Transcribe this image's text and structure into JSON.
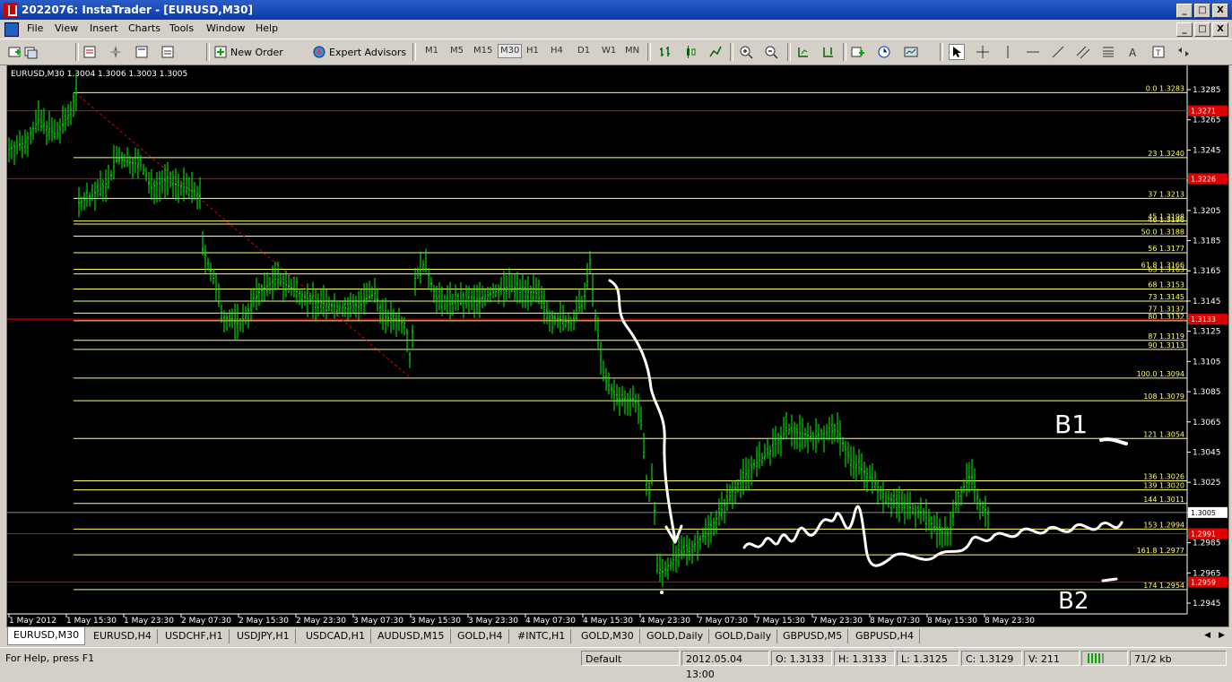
{
  "window": {
    "title": "2022076: InstaTrader - [EURUSD,M30]",
    "min": "_",
    "max": "□",
    "close": "X"
  },
  "menu": [
    "File",
    "View",
    "Insert",
    "Charts",
    "Tools",
    "Window",
    "Help"
  ],
  "toolbar": {
    "new_order": "New Order",
    "expert_advisors": "Expert Advisors",
    "timeframes": [
      "M1",
      "M5",
      "M15",
      "M30",
      "H1",
      "H4",
      "D1",
      "W1",
      "MN"
    ],
    "active_timeframe": "M30"
  },
  "chart": {
    "symbol_info": "EURUSD,M30  1.3004 1.3006 1.3003 1.3005",
    "price_axis": [
      "1.3285",
      "1.3265",
      "1.3245",
      "1.3225",
      "1.3205",
      "1.3185",
      "1.3165",
      "1.3145",
      "1.3125",
      "1.3105",
      "1.3085",
      "1.3065",
      "1.3045",
      "1.3025",
      "1.3005",
      "1.2985",
      "1.2965",
      "1.2945"
    ],
    "time_axis": [
      "1 May 2012",
      "1 May 15:30",
      "1 May 23:30",
      "2 May 07:30",
      "2 May 15:30",
      "2 May 23:30",
      "3 May 07:30",
      "3 May 15:30",
      "3 May 23:30",
      "4 May 07:30",
      "4 May 15:30",
      "4 May 23:30",
      "7 May 07:30",
      "7 May 15:30",
      "7 May 23:30",
      "8 May 07:30",
      "8 May 15:30",
      "8 May 23:30"
    ],
    "fib_levels": [
      {
        "label": "0.0 1.3283",
        "price": 1.3283
      },
      {
        "label": "23 1.3240",
        "price": 1.324
      },
      {
        "label": "37 1.3213",
        "price": 1.3213
      },
      {
        "label": "45 1.3198",
        "price": 1.3198
      },
      {
        "label": "46 1.3196",
        "price": 1.3196
      },
      {
        "label": "50.0 1.3188",
        "price": 1.3188
      },
      {
        "label": "56 1.3177",
        "price": 1.3177
      },
      {
        "label": "61.8 1.3166",
        "price": 1.3166
      },
      {
        "label": "63 1.3163",
        "price": 1.3163
      },
      {
        "label": "68 1.3153",
        "price": 1.3153
      },
      {
        "label": "73 1.3145",
        "price": 1.3145
      },
      {
        "label": "77 1.3137",
        "price": 1.3137
      },
      {
        "label": "80 1.3132",
        "price": 1.3132
      },
      {
        "label": "87 1.3119",
        "price": 1.3119
      },
      {
        "label": "90 1.3113",
        "price": 1.3113
      },
      {
        "label": "100.0 1.3094",
        "price": 1.3094
      },
      {
        "label": "108 1.3079",
        "price": 1.3079
      },
      {
        "label": "121 1.3054",
        "price": 1.3054
      },
      {
        "label": "136 1.3026",
        "price": 1.3026
      },
      {
        "label": "139 1.3020",
        "price": 1.302
      },
      {
        "label": "144 1.3011",
        "price": 1.3011
      },
      {
        "label": "153 1.2994",
        "price": 1.2994
      },
      {
        "label": "161.8 1.2977",
        "price": 1.2977
      },
      {
        "label": "174 1.2954",
        "price": 1.2954
      }
    ],
    "red_levels": [
      {
        "label": "1.3271",
        "price": 1.3271
      },
      {
        "label": "1.3226",
        "price": 1.3226
      },
      {
        "label": "1.3133",
        "price": 1.3133
      },
      {
        "label": "1.2991",
        "price": 1.2991
      },
      {
        "label": "1.2959",
        "price": 1.2959
      }
    ],
    "current_price": "1.3005",
    "annotations": {
      "b1": "B1",
      "b2": "B2"
    },
    "colors": {
      "background": "#000000",
      "candles": "#00ff00",
      "fib": "#ffff66",
      "red": "#e00000",
      "drawing": "#ffffff",
      "axis_text": "#ffffff"
    }
  },
  "tabs": [
    "EURUSD,M30",
    "EURUSD,H4",
    "USDCHF,H1",
    "USDJPY,H1",
    "USDCAD,H1",
    "AUDUSD,M15",
    "GOLD,H4",
    "#INTC,H1",
    "GOLD,M30",
    "GOLD,Daily",
    "GOLD,Daily",
    "GBPUSD,M5",
    "GBPUSD,H4"
  ],
  "active_tab": "EURUSD,M30",
  "status": {
    "help": "For Help, press F1",
    "profile": "Default",
    "datetime": "2012.05.04 13:00",
    "open": "O: 1.3133",
    "high": "H: 1.3133",
    "low": "L: 1.3125",
    "close": "C: 1.3129",
    "volume": "V: 211",
    "traffic": "71/2 kb"
  }
}
